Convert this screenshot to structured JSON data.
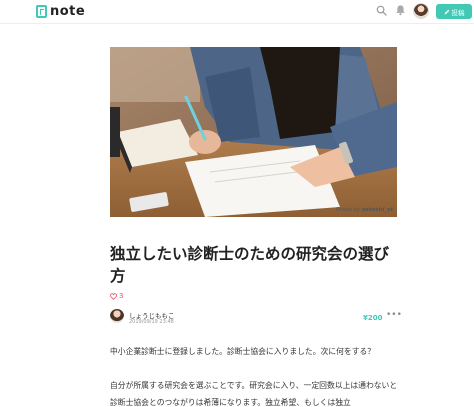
{
  "header": {
    "logo_text": "note",
    "post_button_label": "投稿",
    "search_icon": "search-icon",
    "bell_icon": "bell-icon",
    "accent_color": "#41c9b4"
  },
  "hero": {
    "credit_prefix": "Photo by ",
    "credit_author": "satoshi_st"
  },
  "article": {
    "title": "独立したい診断士のための研究会の選び方",
    "likes": "3",
    "author_name": "しょうじももこ",
    "date": "2019/09/19 23:48",
    "price": "¥200",
    "more_label": "•••",
    "paragraph_1": "中小企業診断士に登録しました。診断士協会に入りました。次に何をする？",
    "paragraph_2": "自分が所属する研究会を選ぶことです。研究会に入り、一定回数以上は通わないと診断士協会とのつながりは希薄になります。独立希望、もしくは独立"
  }
}
